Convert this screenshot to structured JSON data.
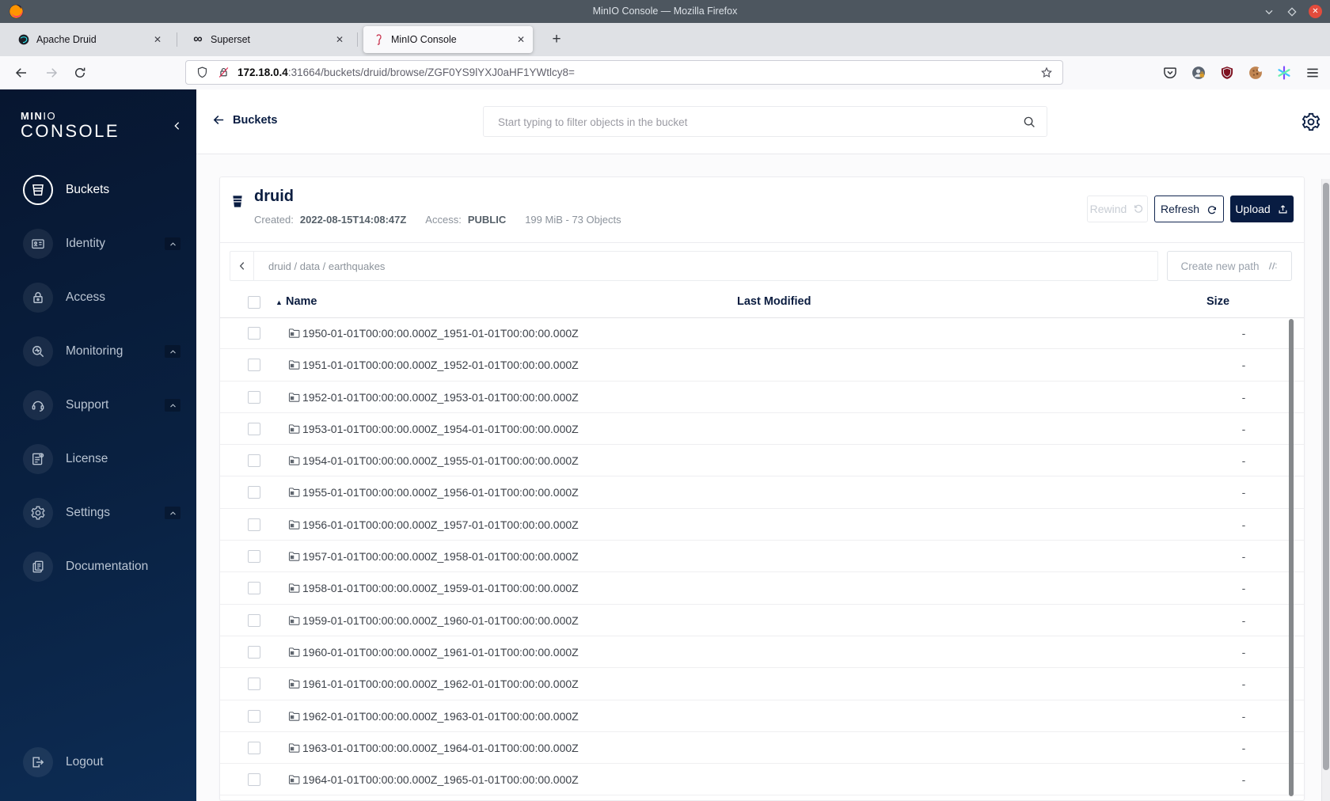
{
  "browser": {
    "window_title": "MinIO Console — Mozilla Firefox",
    "tabs": [
      {
        "label": "Apache Druid",
        "icon": "druid-favicon"
      },
      {
        "label": "Superset",
        "icon": "superset-favicon"
      },
      {
        "label": "MinIO Console",
        "icon": "minio-flamingo-favicon",
        "active": true
      }
    ],
    "new_tab_label": "+",
    "url_host": "172.18.0.4",
    "url_rest": ":31664/buckets/druid/browse/ZGF0YS9lYXJ0aHF1YWtlcy8=",
    "toolbar_icons": [
      "pocket-icon",
      "account-icon",
      "ublock-shield-icon",
      "cookie-icon",
      "extensions-asterisk-icon",
      "menu-icon"
    ]
  },
  "sidebar": {
    "logo_bold": "MIN",
    "logo_light": "IO",
    "logo_main": "CONSOLE",
    "items": [
      {
        "label": "Buckets",
        "icon": "bucket-icon",
        "selected": true,
        "expandable": false
      },
      {
        "label": "Identity",
        "icon": "identity-card-icon",
        "selected": false,
        "expandable": true
      },
      {
        "label": "Access",
        "icon": "lock-icon",
        "selected": false,
        "expandable": false
      },
      {
        "label": "Monitoring",
        "icon": "monitoring-icon",
        "selected": false,
        "expandable": true
      },
      {
        "label": "Support",
        "icon": "support-icon",
        "selected": false,
        "expandable": true
      },
      {
        "label": "License",
        "icon": "license-icon",
        "selected": false,
        "expandable": false
      },
      {
        "label": "Settings",
        "icon": "settings-gear-icon",
        "selected": false,
        "expandable": true
      },
      {
        "label": "Documentation",
        "icon": "documentation-icon",
        "selected": false,
        "expandable": false
      }
    ],
    "logout_label": "Logout"
  },
  "header": {
    "back_label": "Buckets",
    "search_placeholder": "Start typing to filter objects in the bucket"
  },
  "bucket": {
    "name": "druid",
    "created_label": "Created:",
    "created": "2022-08-15T14:08:47Z",
    "access_label": "Access:",
    "access": "PUBLIC",
    "stats": "199 MiB - 73 Objects",
    "rewind_label": "Rewind",
    "refresh_label": "Refresh",
    "upload_label": "Upload"
  },
  "path_bar": {
    "breadcrumb": [
      "druid",
      "data",
      "earthquakes"
    ],
    "create_button": "Create new path"
  },
  "table": {
    "name_header": "Name",
    "last_modified_header": "Last Modified",
    "size_header": "Size",
    "rows": [
      {
        "name": "1950-01-01T00:00:00.000Z_1951-01-01T00:00:00.000Z",
        "size": "-"
      },
      {
        "name": "1951-01-01T00:00:00.000Z_1952-01-01T00:00:00.000Z",
        "size": "-"
      },
      {
        "name": "1952-01-01T00:00:00.000Z_1953-01-01T00:00:00.000Z",
        "size": "-"
      },
      {
        "name": "1953-01-01T00:00:00.000Z_1954-01-01T00:00:00.000Z",
        "size": "-"
      },
      {
        "name": "1954-01-01T00:00:00.000Z_1955-01-01T00:00:00.000Z",
        "size": "-"
      },
      {
        "name": "1955-01-01T00:00:00.000Z_1956-01-01T00:00:00.000Z",
        "size": "-"
      },
      {
        "name": "1956-01-01T00:00:00.000Z_1957-01-01T00:00:00.000Z",
        "size": "-"
      },
      {
        "name": "1957-01-01T00:00:00.000Z_1958-01-01T00:00:00.000Z",
        "size": "-"
      },
      {
        "name": "1958-01-01T00:00:00.000Z_1959-01-01T00:00:00.000Z",
        "size": "-"
      },
      {
        "name": "1959-01-01T00:00:00.000Z_1960-01-01T00:00:00.000Z",
        "size": "-"
      },
      {
        "name": "1960-01-01T00:00:00.000Z_1961-01-01T00:00:00.000Z",
        "size": "-"
      },
      {
        "name": "1961-01-01T00:00:00.000Z_1962-01-01T00:00:00.000Z",
        "size": "-"
      },
      {
        "name": "1962-01-01T00:00:00.000Z_1963-01-01T00:00:00.000Z",
        "size": "-"
      },
      {
        "name": "1963-01-01T00:00:00.000Z_1964-01-01T00:00:00.000Z",
        "size": "-"
      },
      {
        "name": "1964-01-01T00:00:00.000Z_1965-01-01T00:00:00.000Z",
        "size": "-"
      }
    ]
  }
}
